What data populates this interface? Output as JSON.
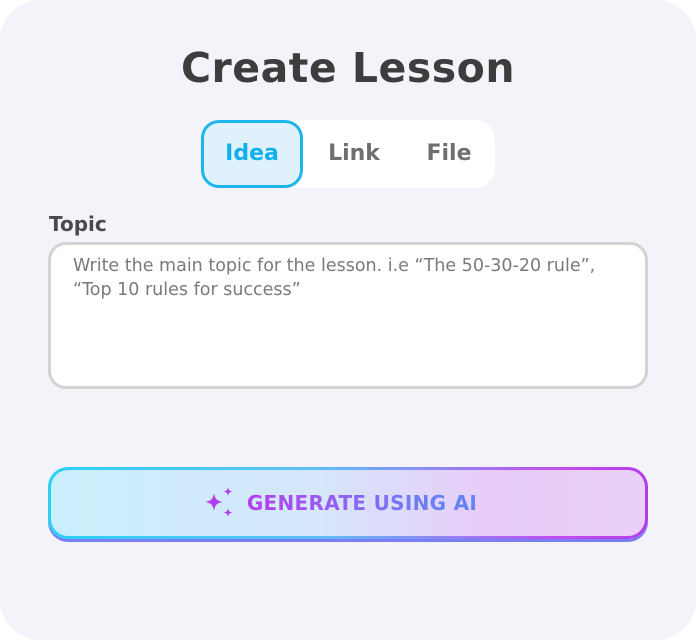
{
  "title": "Create Lesson",
  "tabs": [
    {
      "label": "Idea",
      "active": true
    },
    {
      "label": "Link",
      "active": false
    },
    {
      "label": "File",
      "active": false
    }
  ],
  "topic": {
    "label": "Topic",
    "value": "",
    "placeholder": "Write the main topic for the lesson. i.e “The 50-30-20 rule”, “Top 10 rules for success”"
  },
  "generate_button": {
    "label": "GENERATE USING AI",
    "icon": "sparkles-icon"
  },
  "colors": {
    "accent": "#13b0ee",
    "background": "#f3f3f9",
    "ai_gradient_start": "#2ad0f4",
    "ai_gradient_end": "#b23de8"
  }
}
